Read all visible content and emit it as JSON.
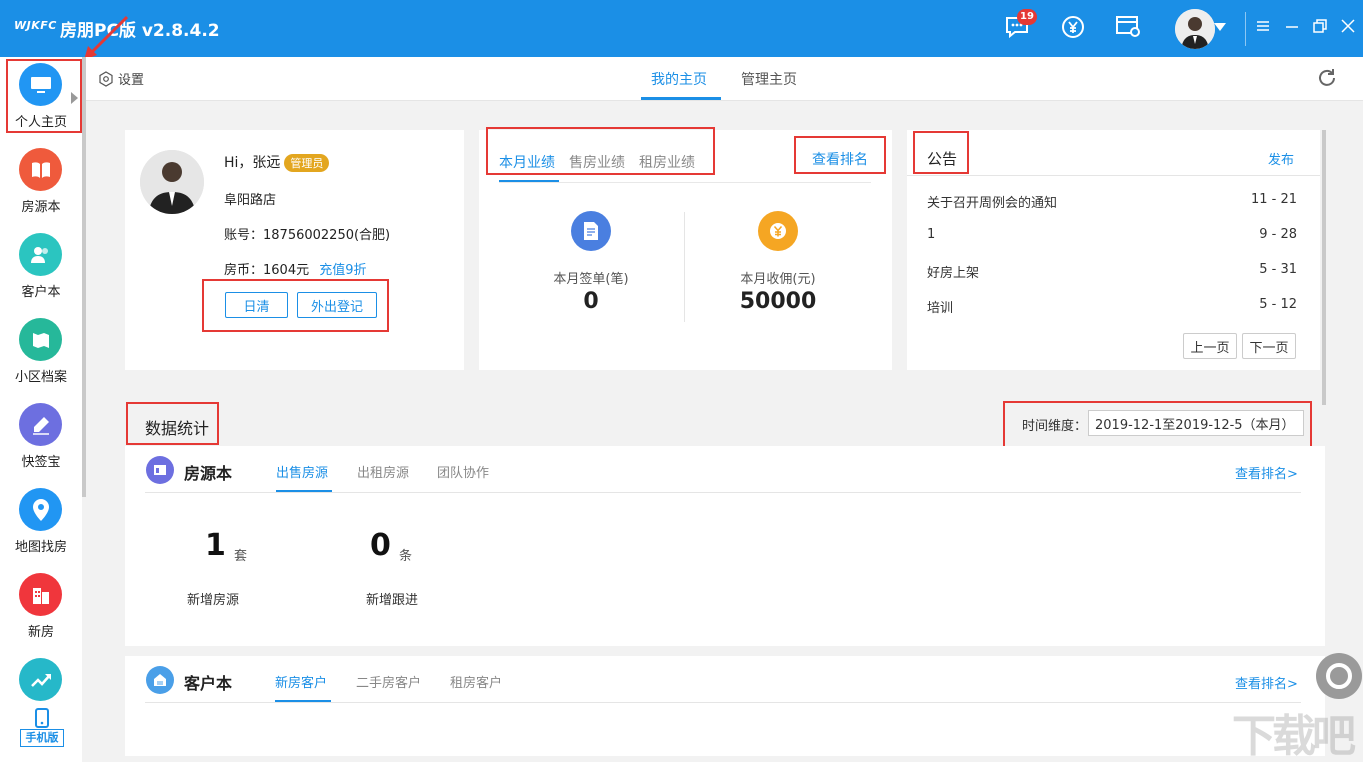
{
  "titlebar": {
    "logo": "WJKFC",
    "app_title": "房朋PC版 v2.8.4.2",
    "message_count": "19"
  },
  "leftnav": {
    "items": [
      {
        "label": "个人主页",
        "icon": "monitor-icon",
        "color": "#2196f3"
      },
      {
        "label": "房源本",
        "icon": "book-icon",
        "color": "#ef5a3c"
      },
      {
        "label": "客户本",
        "icon": "users-icon",
        "color": "#2bc5c0"
      },
      {
        "label": "小区档案",
        "icon": "map-book-icon",
        "color": "#26b89a"
      },
      {
        "label": "快签宝",
        "icon": "sign-icon",
        "color": "#6d6fe0"
      },
      {
        "label": "地图找房",
        "icon": "location-pin-icon",
        "color": "#2196f3"
      },
      {
        "label": "新房",
        "icon": "building-icon",
        "color": "#f0363c"
      },
      {
        "label": "",
        "icon": "trend-icon",
        "color": "#26b8c9"
      }
    ],
    "mobile_label": "手机版"
  },
  "topbar": {
    "settings_label": "设置",
    "tabs": [
      "我的主页",
      "管理主页"
    ]
  },
  "profile": {
    "greeting": "Hi，张远",
    "role_badge": "管理员",
    "store": "阜阳路店",
    "account": "账号：18756002250(合肥)",
    "coins": "房币：1604元",
    "recharge_link": "充值9折",
    "btn_daily": "日清",
    "btn_outing": "外出登记"
  },
  "performance": {
    "tabs": [
      "本月业绩",
      "售房业绩",
      "租房业绩"
    ],
    "rank_link": "查看排名",
    "signed_label": "本月签单(笔)",
    "signed_value": "0",
    "commission_label": "本月收佣(元)",
    "commission_value": "50000"
  },
  "notice": {
    "title": "公告",
    "publish_link": "发布",
    "rows": [
      {
        "title": "关于召开周例会的通知",
        "date": "11 - 21"
      },
      {
        "title": "1",
        "date": "9 - 28"
      },
      {
        "title": "好房上架",
        "date": "5 - 31"
      },
      {
        "title": "培训",
        "date": "5 - 12"
      }
    ],
    "prev_page": "上一页",
    "next_page": "下一页"
  },
  "stats": {
    "title": "数据统计",
    "time_label": "时间维度：",
    "time_value": "2019-12-1至2019-12-5（本月）"
  },
  "listings": {
    "title": "房源本",
    "tabs": [
      "出售房源",
      "出租房源",
      "团队协作"
    ],
    "rank_link": "查看排名>",
    "metrics": [
      {
        "value": "1",
        "unit": "套",
        "label": "新增房源"
      },
      {
        "value": "0",
        "unit": "条",
        "label": "新增跟进"
      }
    ]
  },
  "customers": {
    "title": "客户本",
    "tabs": [
      "新房客户",
      "二手房客户",
      "租房客户"
    ],
    "rank_link": "查看排名>"
  },
  "watermark": "下载吧"
}
